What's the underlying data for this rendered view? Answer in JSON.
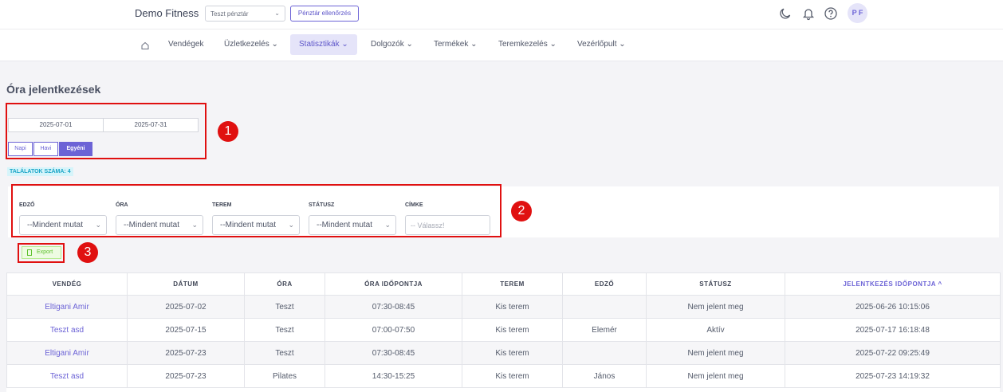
{
  "header": {
    "brand": "Demo Fitness",
    "register_select": "Teszt pénztár",
    "check_button": "Pénztár ellenőrzés",
    "avatar_initials": "P F"
  },
  "nav": {
    "items": [
      {
        "label": "Vendégek"
      },
      {
        "label": "Üzletkezelés"
      },
      {
        "label": "Statisztikák"
      },
      {
        "label": "Dolgozók"
      },
      {
        "label": "Termékek"
      },
      {
        "label": "Teremkezelés"
      },
      {
        "label": "Vezérlőpult"
      }
    ],
    "active": "Statisztikák"
  },
  "page": {
    "title": "Óra jelentkezések",
    "date_from": "2025-07-01",
    "date_to": "2025-07-31",
    "period_buttons": [
      "Napi",
      "Havi",
      "Egyéni"
    ],
    "active_period": "Egyéni",
    "result_count": "TALÁLATOK SZÁMA: 4"
  },
  "filters": {
    "labels": [
      "EDZŐ",
      "ÓRA",
      "TEREM",
      "STÁTUSZ",
      "CÍMKE"
    ],
    "selects": [
      "--Mindent mutat",
      "--Mindent mutat",
      "--Mindent mutat",
      "--Mindent mutat"
    ],
    "tag_placeholder": "-- Válassz!"
  },
  "export_label": "Export",
  "annotations": [
    "1",
    "2",
    "3"
  ],
  "table": {
    "headers": [
      "VENDÉG",
      "DÁTUM",
      "ÓRA",
      "ÓRA IDŐPONTJA",
      "TEREM",
      "EDZŐ",
      "STÁTUSZ",
      "JELENTKEZÉS IDŐPONTJA"
    ],
    "sorted_column": "JELENTKEZÉS IDŐPONTJA",
    "sort_indicator": "^",
    "rows": [
      [
        "Eltigani Amir",
        "2025-07-02",
        "Teszt",
        "07:30-08:45",
        "Kis terem",
        "",
        "Nem jelent meg",
        "2025-06-26 10:15:06"
      ],
      [
        "Teszt asd",
        "2025-07-15",
        "Teszt",
        "07:00-07:50",
        "Kis terem",
        "Elemér",
        "Aktív",
        "2025-07-17 16:18:48"
      ],
      [
        "Eltigani Amir",
        "2025-07-23",
        "Teszt",
        "07:30-08:45",
        "Kis terem",
        "",
        "Nem jelent meg",
        "2025-07-22 09:25:49"
      ],
      [
        "Teszt asd",
        "2025-07-23",
        "Pilates",
        "14:30-15:25",
        "Kis terem",
        "János",
        "Nem jelent meg",
        "2025-07-23 14:19:32"
      ]
    ]
  },
  "colors": {
    "accent": "#6c63d6",
    "annotation_red": "#e01010",
    "badge_bg": "#d6f4fa",
    "export_green": "#5ec12d"
  }
}
